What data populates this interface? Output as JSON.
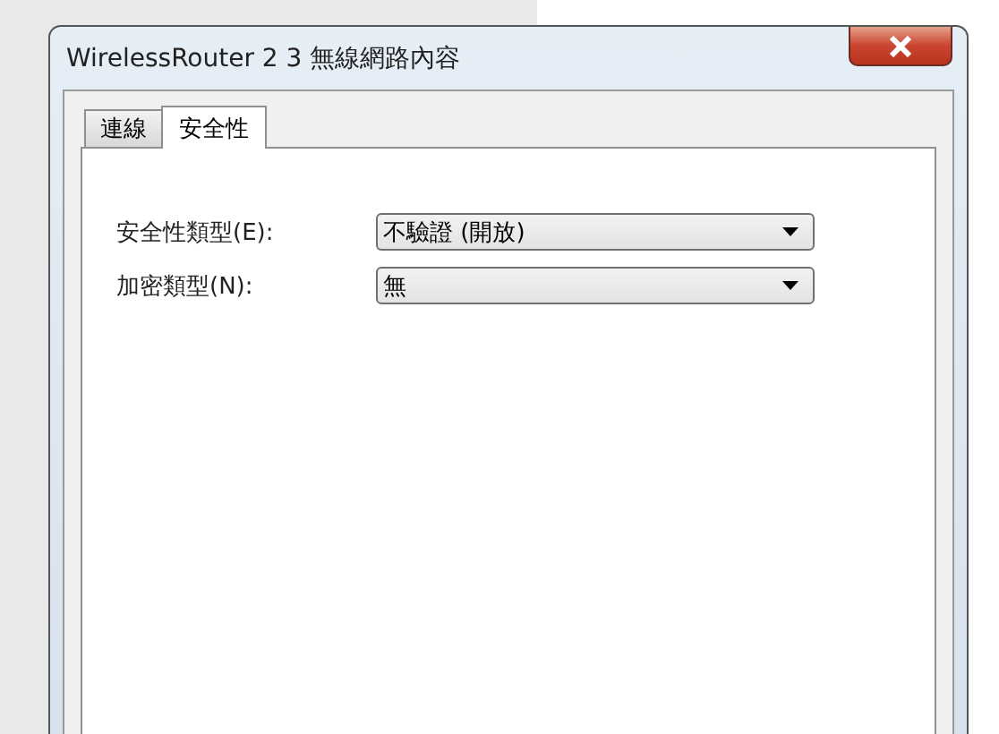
{
  "window": {
    "title": "WirelessRouter 2 3 無線網路內容"
  },
  "tabs": [
    {
      "label": "連線",
      "selected": false
    },
    {
      "label": "安全性",
      "selected": true
    }
  ],
  "fields": [
    {
      "label": "安全性類型(E):",
      "value": "不驗證 (開放)"
    },
    {
      "label": "加密類型(N):",
      "value": "無"
    }
  ]
}
